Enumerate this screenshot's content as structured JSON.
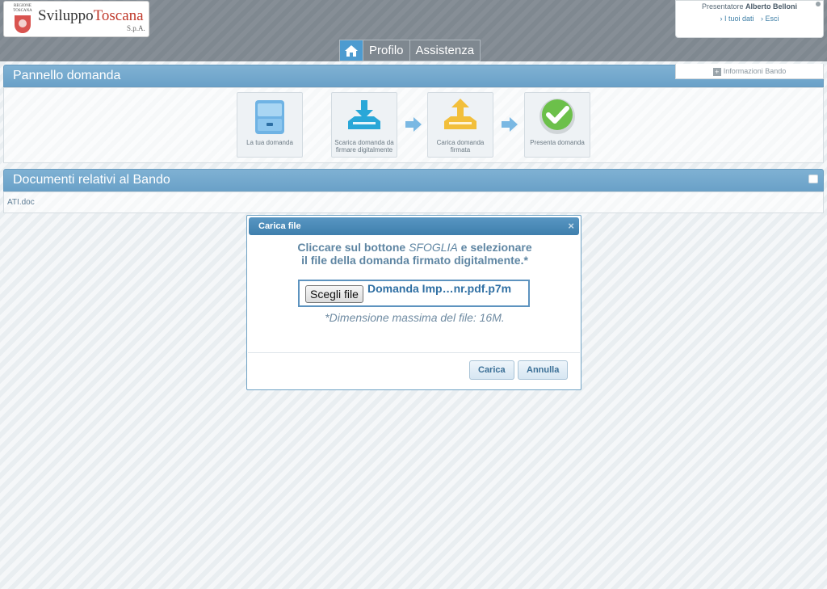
{
  "header": {
    "logo": {
      "crest_text": "REGIONE TOSCANA",
      "title_main": "Sviluppo",
      "title_accent": "Toscana",
      "subtitle": "S.p.A."
    },
    "user": {
      "presenter_label": "Presentatore",
      "presenter_name": "Alberto Belloni",
      "link_my_data": "› I tuoi dati",
      "link_exit": "› Esci"
    },
    "nav": {
      "home_icon": "home-icon",
      "items": [
        "Profilo",
        "Assistenza"
      ]
    },
    "info_bando": "Informazioni Bando"
  },
  "panel_domanda": {
    "title": "Pannello domanda",
    "steps": [
      {
        "label": "La tua domanda",
        "icon": "cabinet-icon"
      },
      {
        "label": "Scarica domanda da firmare digitalmente",
        "icon": "download-tray-icon"
      },
      {
        "label": "Carica domanda firmata",
        "icon": "upload-tray-icon"
      },
      {
        "label": "Presenta domanda",
        "icon": "checkmark-icon"
      }
    ]
  },
  "panel_documenti": {
    "title": "Documenti relativi al Bando",
    "documents": [
      "ATI.doc"
    ]
  },
  "modal": {
    "title": "Carica file",
    "close": "×",
    "instruction_before": "Cliccare sul bottone ",
    "instruction_em": "SFOGLIA",
    "instruction_after": " e selezionare",
    "instruction_line2": "il file della domanda firmato digitalmente.*",
    "choose_button": "Scegli file",
    "file_name": "Domanda Imp…nr.pdf.p7m",
    "note": "*Dimensione massima del file: 16M.",
    "upload_button": "Carica",
    "cancel_button": "Annulla"
  },
  "colors": {
    "header_bg": "#7f8890",
    "panel_header": "#6aa1c8",
    "nav_home_active": "#4d9bd0",
    "modal_header": "#3f7fad",
    "brand_red": "#c0392b"
  }
}
